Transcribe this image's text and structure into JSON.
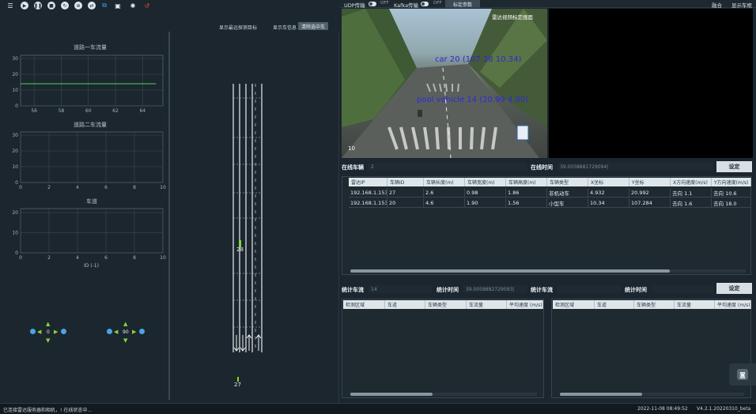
{
  "toolbar": {
    "icons": [
      "menu-icon",
      "play-icon",
      "pause-icon",
      "stop-icon",
      "refresh-icon",
      "zoom-icon",
      "network-icon",
      "save-icon",
      "settings-icon",
      "reset-icon"
    ]
  },
  "top_bar": {
    "udp_label": "UDP传输",
    "udp_state": "OFF",
    "kafka_label": "Kafka传输",
    "kafka_state": "OFF",
    "param_button": "标定参数",
    "fusion_label": "融合",
    "show_vehicle_label": "显示车框"
  },
  "left_controls": {
    "show_trail_label": "显示最远探测目标",
    "show_info_label": "显示车信息",
    "clear_button": "清除选中车"
  },
  "charts": [
    {
      "title": "道路一车流量",
      "yticks": [
        "30",
        "20",
        "10",
        "0"
      ],
      "xticks": [
        "56",
        "58",
        "60",
        "62",
        "64"
      ]
    },
    {
      "title": "道路二车流量",
      "yticks": [
        "30",
        "20",
        "10",
        "0"
      ],
      "xticks": [
        "0",
        "2",
        "4",
        "6",
        "8",
        "10"
      ]
    },
    {
      "title": "车道",
      "yticks": [
        "20",
        "10",
        "0"
      ],
      "xticks": [
        "0",
        "2",
        "4",
        "6",
        "8",
        "10"
      ],
      "xlabel": "ID (-1)"
    }
  ],
  "chart_data": [
    {
      "type": "line",
      "title": "道路一车流量",
      "x": [
        55,
        65
      ],
      "series": [
        {
          "values": [
            14,
            14
          ]
        }
      ],
      "xlim": [
        55,
        65.5
      ],
      "ylim": [
        0,
        32
      ],
      "grid": true,
      "color": "#52d35c"
    },
    {
      "type": "line",
      "title": "道路二车流量",
      "series": [],
      "xlim": [
        0,
        10
      ],
      "ylim": [
        0,
        32
      ],
      "grid": true
    },
    {
      "type": "line",
      "title": "车道",
      "xlabel": "ID (-1)",
      "series": [],
      "xlim": [
        0,
        10
      ],
      "ylim": [
        0,
        22
      ],
      "grid": true
    }
  ],
  "radar_panel": {
    "controls": [
      {
        "angle": "0"
      },
      {
        "angle": "90"
      }
    ],
    "vehicle_ids": [
      "28",
      "27"
    ]
  },
  "camera": {
    "label_top": "雷达视频标定画面",
    "detections": [
      {
        "label": "car 20 (107.28 10.34)"
      },
      {
        "label": "pool vehicle 14 (20.99 4.00)"
      }
    ],
    "corner_label": "10"
  },
  "online": {
    "vehicles_label": "在线车辆",
    "vehicles_value": "2",
    "time_label": "在线时间",
    "time_value": "39.0038881729094|",
    "set_button": "设定",
    "columns": [
      "雷达IP",
      "车辆ID",
      "车辆长度(m)",
      "车辆宽度(m)",
      "车辆高度(m)",
      "车辆类型",
      "X坐标",
      "Y坐标",
      "X方向速度(m/s)",
      "Y方向速度(m/s)"
    ],
    "rows": [
      [
        "192.168.1.153",
        "27",
        "2.6",
        "0.98",
        "1.86",
        "非机动车",
        "4.932",
        "20.992",
        "去向 1.1",
        "去向 10.6"
      ],
      [
        "192.168.1.153",
        "20",
        "4.6",
        "1.90",
        "1.56",
        "小型车",
        "10.34",
        "107.284",
        "去向 1.6",
        "去向 18.0"
      ]
    ]
  },
  "stats": {
    "flow_label": "统计车流",
    "flow_value": "14",
    "time_label": "统计时间",
    "time_value": "39.0058882729093|",
    "flow_label2": "统计车流",
    "time_label2": "统计时间",
    "set_button": "设定",
    "columns_left": [
      "检测区域",
      "车道",
      "车辆类型",
      "车流量",
      "平均速度 (m/s)"
    ],
    "columns_right": [
      "检测区域",
      "车道",
      "车辆类型",
      "车流量",
      "平均速度 (m/s)"
    ]
  },
  "status": {
    "message": "已连接雷达服务器和相机，! 在线状态中...",
    "datetime": "2022-11-08 08:49:52",
    "version": "V4.2.1.20220310_beta"
  }
}
